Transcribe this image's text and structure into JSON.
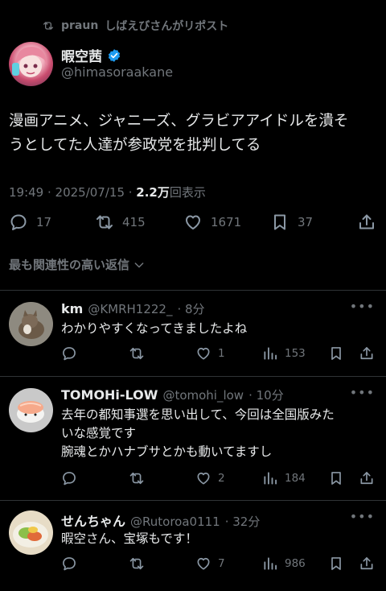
{
  "repost": {
    "user": "praun",
    "text": "しばえびさんがリポスト"
  },
  "post": {
    "name": "暇空茜",
    "handle": "@himasoraakane",
    "text_line1": "漫画アニメ、ジャニーズ、グラビアアイドルを潰そ",
    "text_line2": "うとしてた人達が参政党を批判してる",
    "time": "19:49 · 2025/07/15 · ",
    "views": "2.2万",
    "views_label": "回表示",
    "replies": "17",
    "reposts": "415",
    "likes": "1671",
    "bookmarks": "37"
  },
  "sort_label": "最も関連性の高い返信",
  "replies": [
    {
      "name": "km",
      "handle": "@KMRH1222_",
      "time": "· 8分",
      "lines": [
        "わかりやすくなってきましたよね"
      ],
      "reposts": "",
      "likes": "1",
      "views": "153"
    },
    {
      "name": "TOMOHi-LOW",
      "handle": "@tomohi_low",
      "time": "· 10分",
      "lines": [
        "去年の都知事選を思い出して、今回は全国版みた",
        "いな感覚です",
        "腕魂とかハナブサとかも動いてますし"
      ],
      "reposts": "",
      "likes": "2",
      "views": "184"
    },
    {
      "name": "せんちゃん",
      "handle": "@Rutoroa0111",
      "time": "· 32分",
      "lines": [
        "暇空さん、宝塚もです！"
      ],
      "reposts": "",
      "likes": "7",
      "views": "986"
    }
  ],
  "colors": {
    "background": "#000000",
    "text": "#e7e9ea",
    "muted": "#71767b",
    "verified": "#1d9bf0",
    "divider": "#2f3336"
  },
  "icons": [
    "repost-icon",
    "verified-badge-icon",
    "reply-icon",
    "like-icon",
    "bookmark-icon",
    "share-icon",
    "views-icon",
    "chevron-down-icon",
    "more-icon"
  ]
}
